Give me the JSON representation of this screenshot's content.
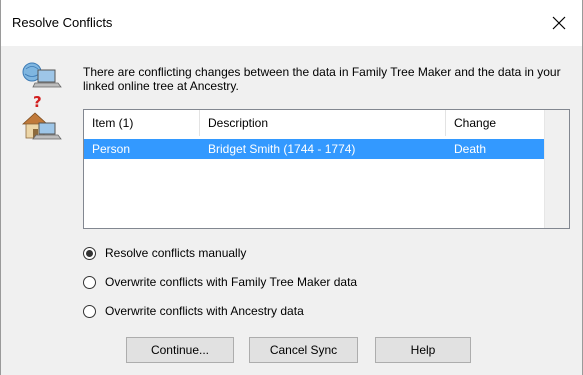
{
  "dialog": {
    "title": "Resolve Conflicts",
    "close_icon": "close-icon",
    "illustration_icon": "sync-conflict-icon",
    "message": "There are conflicting changes between the data in Family Tree Maker and the data in your linked online tree at Ancestry."
  },
  "list": {
    "columns": [
      "Item (1)",
      "Description",
      "Change"
    ],
    "rows": [
      {
        "item": "Person",
        "description": "Bridget Smith (1744 - 1774)",
        "change": "Death",
        "selected": true
      }
    ],
    "selection_color": "#3399ff"
  },
  "options": [
    {
      "label": "Resolve conflicts manually",
      "checked": true
    },
    {
      "label": "Overwrite conflicts with Family Tree Maker data",
      "checked": false
    },
    {
      "label": "Overwrite conflicts with Ancestry data",
      "checked": false
    }
  ],
  "buttons": {
    "continue": "Continue...",
    "cancel_sync": "Cancel Sync",
    "help": "Help"
  }
}
